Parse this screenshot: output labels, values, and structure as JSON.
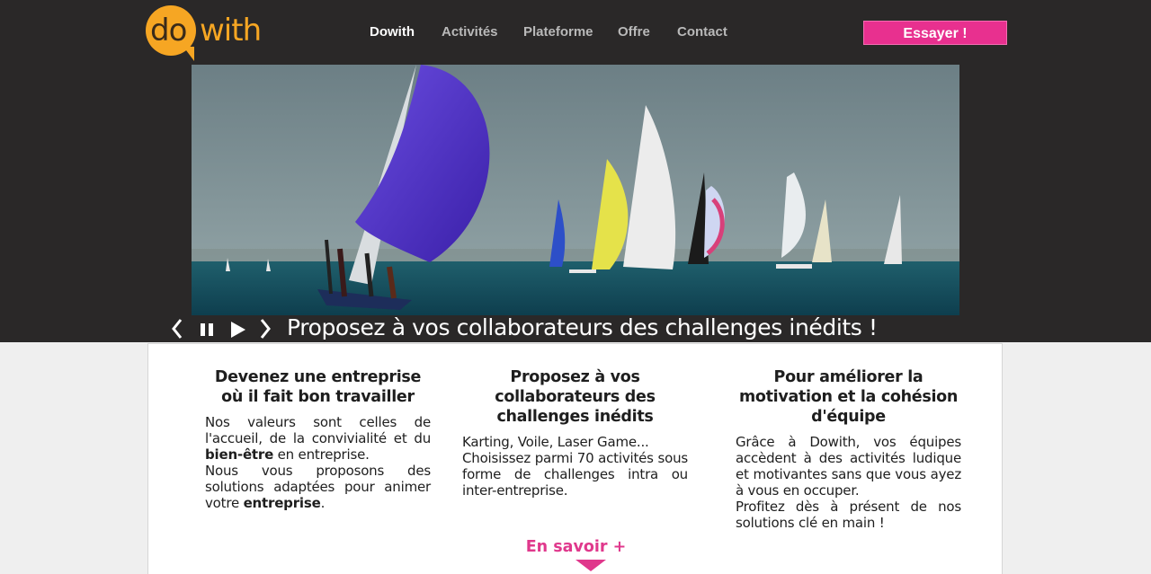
{
  "brand": {
    "logo_do": "do",
    "logo_with": "with",
    "primary": "#f6a623",
    "accent": "#e8308f"
  },
  "nav": {
    "items": [
      {
        "label": "Dowith",
        "active": true
      },
      {
        "label": "Activités"
      },
      {
        "label": "Plateforme"
      },
      {
        "label": "Offre"
      },
      {
        "label": "Contact"
      }
    ],
    "cta_label": "Essayer !"
  },
  "hero": {
    "image_alt": "",
    "caption": "Proposez à vos collaborateurs des challenges inédits !",
    "controls": {
      "prev": "prev-icon",
      "pause": "pause-icon",
      "play": "play-icon",
      "next": "next-icon"
    }
  },
  "features": [
    {
      "title": "Devenez une entreprise où il fait bon travailler",
      "html": "Nos valeurs sont celles de l'accueil, de la convivialité et du <b>bien-être</b> en entreprise.<br>Nous vous proposons des solutions adaptées pour animer votre <b>entreprise</b>."
    },
    {
      "title": "Proposez à vos collaborateurs des challenges inédits",
      "html": "Karting, Voile, Laser Game...<br>Choisissez parmi 70 activités sous forme de challenges intra ou inter-entreprise."
    },
    {
      "title": "Pour améliorer la motivation et la cohésion d'équipe",
      "html": "Grâce à Dowith, vos équipes accèdent à des activités ludique et motivantes sans que vous ayez à vous en occuper.<br>Profitez dès à présent de nos solutions clé en main !"
    }
  ],
  "more_label": "En savoir +"
}
